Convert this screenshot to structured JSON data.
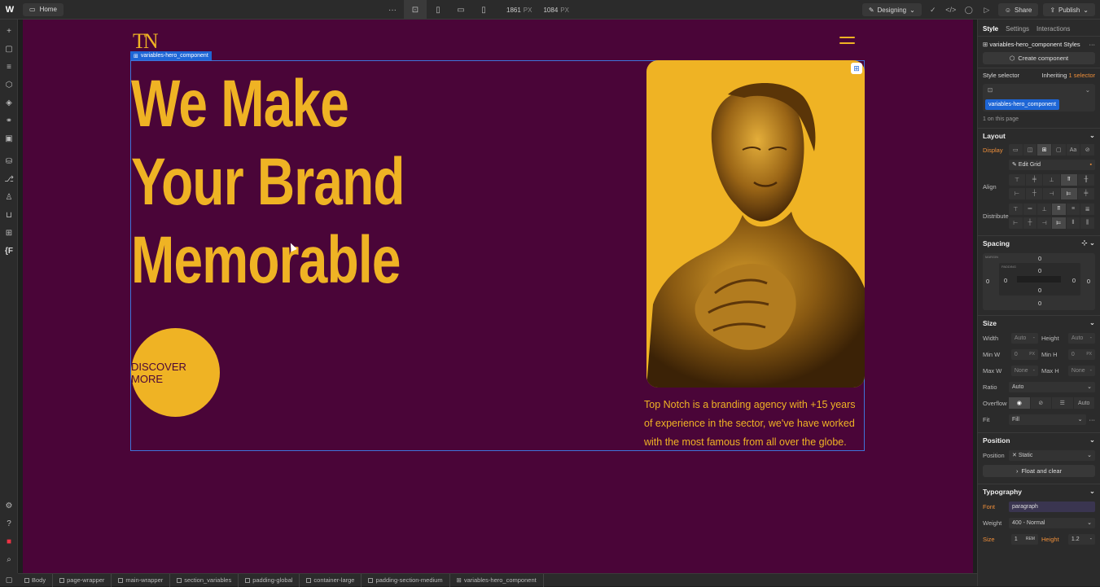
{
  "topbar": {
    "logo": "W",
    "page_name": "Home",
    "more": "···",
    "width_value": "1861",
    "width_unit": "PX",
    "height_value": "1084",
    "height_unit": "PX",
    "mode": "Designing",
    "share": "Share",
    "publish": "Publish"
  },
  "canvas": {
    "brand_logo": "TN",
    "selection_tag": "variables-hero_component",
    "headline": [
      "We Make",
      "Your Brand",
      "Memorable"
    ],
    "discover_button": "DISCOVER MORE",
    "hero_text": "Top Notch is a branding agency with +15 years of experience in the sector, we've have worked with the most famous from all over the globe.",
    "colors": {
      "background": "#4a0538",
      "accent": "#efb324"
    }
  },
  "left_toolbar": {
    "icons": [
      "add-icon",
      "pages-icon",
      "navigator-icon",
      "components-icon",
      "styles-icon",
      "variables-icon",
      "assets-icon",
      "cms-icon",
      "logic-icon",
      "users-icon",
      "ecommerce-icon",
      "apps-icon"
    ],
    "text_icon": "{F",
    "bottom_icons": [
      "settings-icon",
      "help-icon",
      "record-icon",
      "search-icon"
    ]
  },
  "right_panel": {
    "tabs": [
      "Style",
      "Settings",
      "Interactions"
    ],
    "component_styles": "variables-hero_component Styles",
    "create_component": "Create component",
    "style_selector_label": "Style selector",
    "inheriting_prefix": "Inheriting",
    "inheriting_count": "1",
    "inheriting_suffix": "selector",
    "selector_chip": "variables-hero_component",
    "on_page": "1 on this page",
    "layout": {
      "title": "Layout",
      "display_label": "Display",
      "edit_grid": "Edit Grid",
      "align_label": "Align",
      "distribute_label": "Distribute"
    },
    "spacing": {
      "title": "Spacing",
      "margin_label": "MARGIN",
      "padding_label": "PADDING",
      "margin_top": "0",
      "margin_right": "0",
      "margin_bottom": "0",
      "margin_left": "0",
      "padding_top": "0",
      "padding_right": "0",
      "padding_bottom": "0",
      "padding_left": "0"
    },
    "size": {
      "title": "Size",
      "width_label": "Width",
      "width_value": "Auto",
      "height_label": "Height",
      "height_value": "Auto",
      "minw_label": "Min W",
      "minw_value": "0",
      "minw_unit": "PX",
      "minh_label": "Min H",
      "minh_value": "0",
      "minh_unit": "PX",
      "maxw_label": "Max W",
      "maxw_value": "None",
      "maxh_label": "Max H",
      "maxh_value": "None",
      "ratio_label": "Ratio",
      "ratio_value": "Auto",
      "overflow_label": "Overflow",
      "overflow_auto": "Auto",
      "fit_label": "Fit",
      "fit_value": "Fill"
    },
    "position": {
      "title": "Position",
      "position_label": "Position",
      "position_value": "Static",
      "float_clear": "Float and clear"
    },
    "typography": {
      "title": "Typography",
      "font_label": "Font",
      "font_value": "paragraph",
      "weight_label": "Weight",
      "weight_value": "400 - Normal",
      "size_label": "Size",
      "size_value": "1",
      "size_unit": "REM",
      "height_label": "Height",
      "height_value": "1.2"
    }
  },
  "breadcrumb": [
    "Body",
    "page-wrapper",
    "main-wrapper",
    "section_variables",
    "padding-global",
    "container-large",
    "padding-section-medium",
    "variables-hero_component"
  ]
}
